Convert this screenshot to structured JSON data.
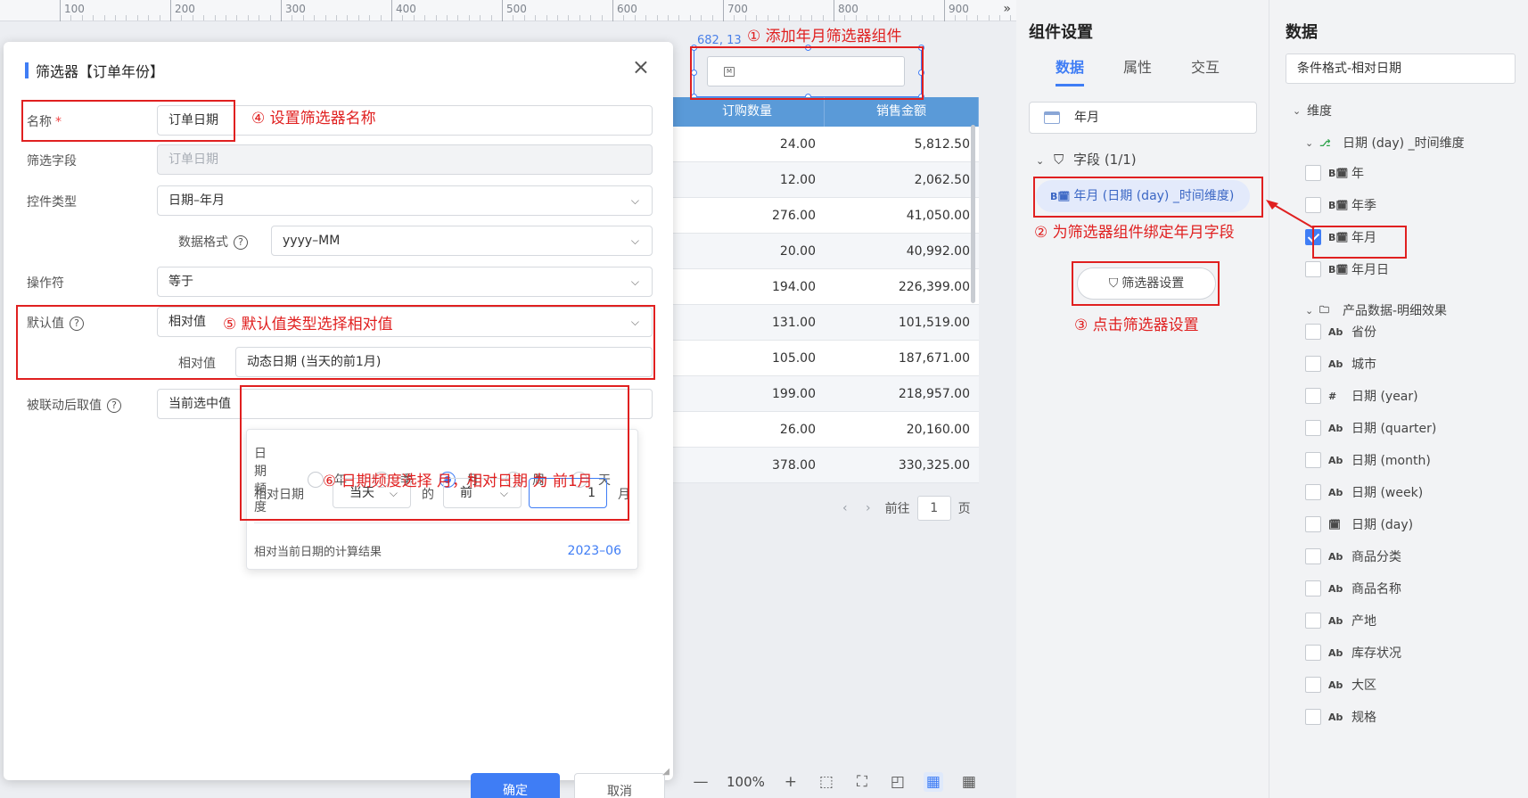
{
  "ruler": {
    "ticks": [
      "100",
      "200",
      "300",
      "400",
      "500",
      "600",
      "700",
      "800",
      "900"
    ]
  },
  "canvas": {
    "coord_label": "682, 13",
    "table": {
      "headers": [
        "订购数量",
        "销售金额"
      ],
      "rows": [
        [
          "24.00",
          "5,812.50"
        ],
        [
          "12.00",
          "2,062.50"
        ],
        [
          "276.00",
          "41,050.00"
        ],
        [
          "20.00",
          "40,992.00"
        ],
        [
          "194.00",
          "226,399.00"
        ],
        [
          "131.00",
          "101,519.00"
        ],
        [
          "105.00",
          "187,671.00"
        ],
        [
          "199.00",
          "218,957.00"
        ],
        [
          "26.00",
          "20,160.00"
        ],
        [
          "378.00",
          "330,325.00"
        ]
      ]
    },
    "pager": {
      "goto_label": "前往",
      "page_value": "1",
      "page_unit": "页"
    },
    "zoom": "100%"
  },
  "dialog": {
    "title": "筛选器【订单年份】",
    "name_label": "名称",
    "name_value": "订单日期",
    "field_label": "筛选字段",
    "field_placeholder": "订单日期",
    "control_type_label": "控件类型",
    "control_type_value": "日期–年月",
    "data_format_label": "数据格式",
    "data_format_value": "yyyy–MM",
    "operator_label": "操作符",
    "operator_value": "等于",
    "default_label": "默认值",
    "default_value": "相对值",
    "relative_label": "相对值",
    "relative_value": "动态日期 (当天的前1月)",
    "linked_label": "被联动后取值",
    "linked_value": "当前选中值",
    "popup": {
      "freq_label": "日期频度",
      "freq_options": [
        "年",
        "季",
        "月",
        "周",
        "天"
      ],
      "freq_selected": "月",
      "rel_date_label": "相对日期",
      "base_value": "当天",
      "of_text": "的",
      "direction_value": "前",
      "amount_value": "1",
      "unit_text": "月",
      "result_label": "相对当前日期的计算结果",
      "result_value": "2023–06"
    },
    "ok_label": "确定",
    "cancel_label": "取消"
  },
  "settings": {
    "title": "组件设置",
    "tabs": [
      "数据",
      "属性",
      "交互"
    ],
    "active_tab": "数据",
    "ym_box": "年月",
    "fields_label": "字段 (1/1)",
    "bound_field": "年月 (日期 (day) _时间维度)",
    "filter_settings_btn": "筛选器设置"
  },
  "data_panel": {
    "title": "数据",
    "dataset": "条件格式-相对日期",
    "dimension_label": "维度",
    "group1": "日期 (day) _时间维度",
    "group1_items": [
      {
        "label": "年",
        "icon": "date-icon",
        "checked": false
      },
      {
        "label": "年季",
        "icon": "date-icon",
        "checked": false
      },
      {
        "label": "年月",
        "icon": "date-icon",
        "checked": true
      },
      {
        "label": "年月日",
        "icon": "date-icon",
        "checked": false
      }
    ],
    "group2": "产品数据-明细效果",
    "group2_items": [
      {
        "label": "省份",
        "icon": "Ab"
      },
      {
        "label": "城市",
        "icon": "Ab"
      },
      {
        "label": "日期 (year)",
        "icon": "#"
      },
      {
        "label": "日期 (quarter)",
        "icon": "Ab"
      },
      {
        "label": "日期 (month)",
        "icon": "Ab"
      },
      {
        "label": "日期 (week)",
        "icon": "Ab"
      },
      {
        "label": "日期 (day)",
        "icon": "calendar"
      },
      {
        "label": "商品分类",
        "icon": "Ab"
      },
      {
        "label": "商品名称",
        "icon": "Ab"
      },
      {
        "label": "产地",
        "icon": "Ab"
      },
      {
        "label": "库存状况",
        "icon": "Ab"
      },
      {
        "label": "大区",
        "icon": "Ab"
      },
      {
        "label": "规格",
        "icon": "Ab"
      }
    ]
  },
  "annotations": {
    "a1": "① 添加年月筛选器组件",
    "a2": "② 为筛选器组件绑定年月字段",
    "a3": "③ 点击筛选器设置",
    "a4": "④ 设置筛选器名称",
    "a5": "⑤ 默认值类型选择相对值",
    "a6": "⑥ 日期频度选择 月，相对日期 为 前1月"
  },
  "colors": {
    "accent": "#3f7df5",
    "annotation": "#e02020",
    "table_header": "#5a9ad8"
  }
}
